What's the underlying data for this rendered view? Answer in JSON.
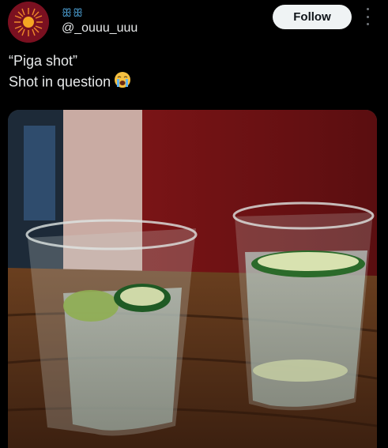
{
  "author": {
    "display_name": "ꕥꕥ",
    "handle": "@_ouuu_uuu"
  },
  "actions": {
    "follow_label": "Follow"
  },
  "icons": {
    "more": "more-vertical-icon",
    "emoji": "loudly-crying-face-emoji"
  },
  "tweet": {
    "line1": "“Piga shot”",
    "line2": "Shot in question"
  },
  "colors": {
    "background": "#000000",
    "text": "#e7e9ea",
    "follow_button_bg": "#eff3f4",
    "display_name": "#4ea3d8"
  }
}
